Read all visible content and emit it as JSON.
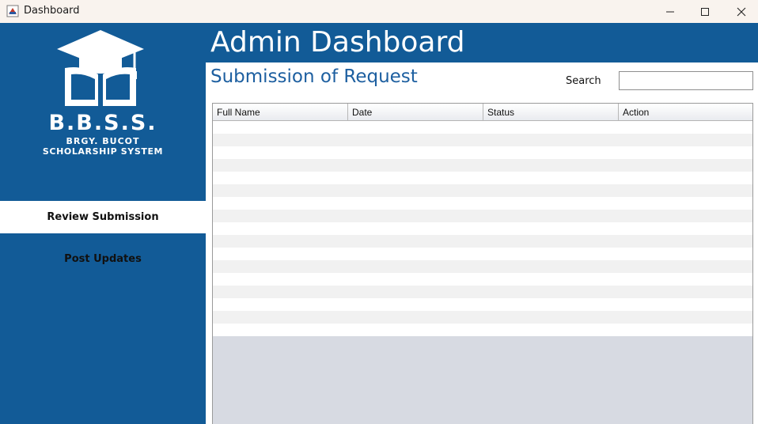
{
  "window": {
    "title": "Dashboard"
  },
  "sidebar": {
    "brand": "B.B.S.S.",
    "brand_line1": "BRGY. BUCOT",
    "brand_line2": "SCHOLARSHIP SYSTEM",
    "items": [
      {
        "label": "Review Submission",
        "active": true
      },
      {
        "label": "Post Updates",
        "active": false
      }
    ]
  },
  "header": {
    "title": "Admin Dashboard"
  },
  "main": {
    "section_title": "Submission of Request",
    "search_label": "Search",
    "search_value": "",
    "table": {
      "columns": [
        "Full Name",
        "Date",
        "Status",
        "Action"
      ],
      "rows": []
    }
  },
  "colors": {
    "primary": "#125b97",
    "section_title": "#1d5fa0",
    "table_empty_bg": "#d7dae2"
  }
}
